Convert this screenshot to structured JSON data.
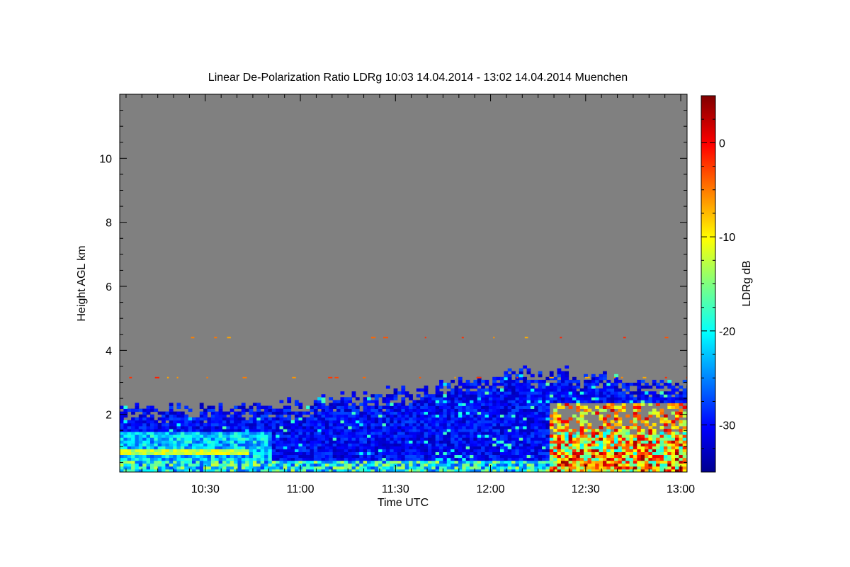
{
  "chart_data": {
    "type": "heatmap",
    "title": "Linear De-Polarization Ratio LDRg   10:03 14.04.2014 - 13:02 14.04.2014 Muenchen",
    "xlabel": "Time UTC",
    "ylabel": "Height AGL km",
    "colorbar_label": "LDRg dB",
    "xlim": [
      "10:03",
      "13:02"
    ],
    "ylim": [
      0.2,
      12
    ],
    "clim": [
      -35,
      5
    ],
    "x_ticks": [
      "10:30",
      "11:00",
      "11:30",
      "12:00",
      "12:30",
      "13:00"
    ],
    "y_ticks": [
      2,
      4,
      6,
      8,
      10
    ],
    "colorbar_ticks": [
      0,
      -10,
      -20,
      -30
    ],
    "colormap": "jet",
    "no_data_color": "#808080",
    "grid": false,
    "cloud_top_km": [
      {
        "time": "10:03",
        "height": 2.2
      },
      {
        "time": "10:30",
        "height": 2.2
      },
      {
        "time": "10:50",
        "height": 2.25
      },
      {
        "time": "11:00",
        "height": 2.35
      },
      {
        "time": "11:20",
        "height": 2.55
      },
      {
        "time": "11:40",
        "height": 2.85
      },
      {
        "time": "12:00",
        "height": 3.1
      },
      {
        "time": "12:10",
        "height": 3.35
      },
      {
        "time": "12:30",
        "height": 3.25
      },
      {
        "time": "12:45",
        "height": 2.95
      },
      {
        "time": "13:00",
        "height": 3.05
      },
      {
        "time": "13:02",
        "height": 3.0
      }
    ],
    "features": [
      {
        "name": "high depolarization near-ground layer",
        "time_start": "12:18",
        "time_end": "13:02",
        "height_top": 1.6,
        "ldr_db": -5
      },
      {
        "name": "enhanced layer",
        "time_start": "10:03",
        "time_end": "10:43",
        "height": 0.75,
        "ldr_db": -12
      },
      {
        "name": "sparse echoes",
        "height": 3.15,
        "ldr_db": -4
      },
      {
        "name": "sparse echoes",
        "height": 4.4,
        "ldr_db": -4
      }
    ]
  }
}
